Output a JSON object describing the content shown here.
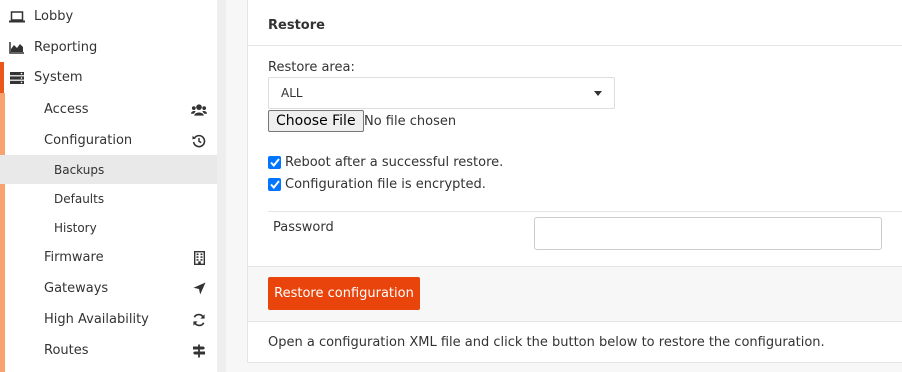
{
  "sidebar": {
    "top_items": [
      {
        "label": "Lobby",
        "icon": "laptop-icon"
      },
      {
        "label": "Reporting",
        "icon": "area-chart-icon"
      },
      {
        "label": "System",
        "icon": "server-icon"
      }
    ],
    "sub_items": [
      {
        "label": "Access",
        "icon": "users-icon"
      },
      {
        "label": "Configuration",
        "icon": "history-icon"
      },
      {
        "label": "Backups"
      },
      {
        "label": "Defaults"
      },
      {
        "label": "History"
      },
      {
        "label": "Firmware",
        "icon": "building-icon"
      },
      {
        "label": "Gateways",
        "icon": "location-arrow-icon"
      },
      {
        "label": "High Availability",
        "icon": "refresh-icon"
      },
      {
        "label": "Routes",
        "icon": "signpost-icon"
      }
    ],
    "selected": "Backups",
    "accent_color": "#e9581a"
  },
  "restore": {
    "title": "Restore",
    "area_label": "Restore area:",
    "area_value": "ALL",
    "file_button": "Choose File",
    "file_status": "No file chosen",
    "reboot_label": "Reboot after a successful restore.",
    "reboot_checked": true,
    "encrypted_label": "Configuration file is encrypted.",
    "encrypted_checked": true,
    "password_label": "Password",
    "password_value": "",
    "button_label": "Restore configuration",
    "button_color": "#e9440b",
    "help_text": "Open a configuration XML file and click the button below to restore the configuration."
  }
}
